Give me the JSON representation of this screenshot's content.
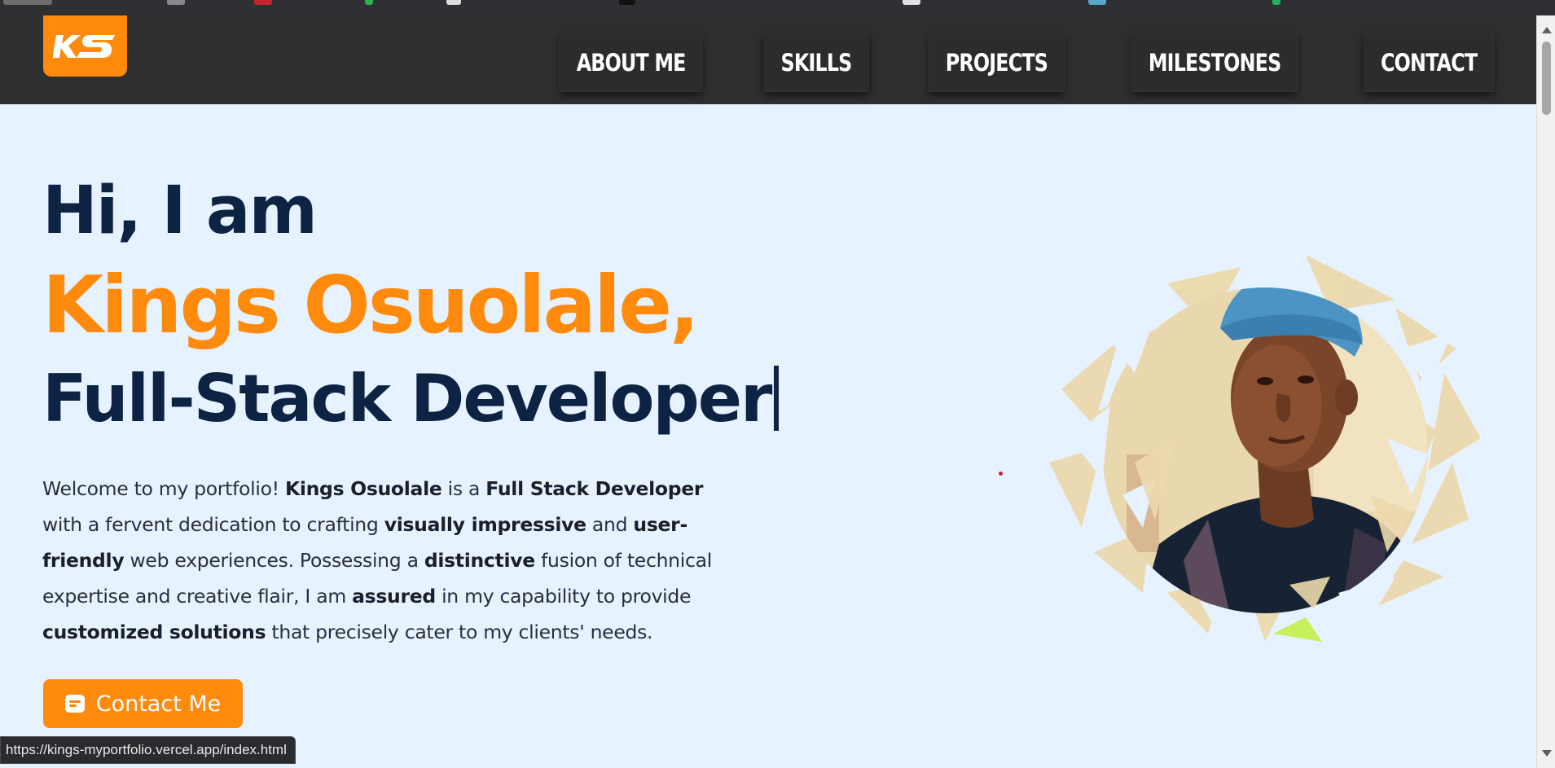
{
  "brand": {
    "logo_text": "KS",
    "accent_color": "#ff8a0c",
    "navy_color": "#0d2344",
    "nav_bg": "#2e2f31",
    "page_bg": "#e6f2ff"
  },
  "nav": {
    "items": [
      {
        "label": "ABOUT ME"
      },
      {
        "label": "SKILLS"
      },
      {
        "label": "PROJECTS"
      },
      {
        "label": "MILESTONES"
      },
      {
        "label": "CONTACT"
      }
    ]
  },
  "hero": {
    "greeting": "Hi, I am",
    "name": "Kings Osuolale,",
    "role": "Full-Stack Developer",
    "bio": {
      "p1": "Welcome to my portfolio! ",
      "b1": "Kings Osuolale",
      "p2": " is a ",
      "b2": "Full Stack Developer",
      "p3": " with a fervent dedication to crafting ",
      "b3": "visually impressive",
      "p4": " and ",
      "b4": "user-friendly",
      "p5": " web experiences. Possessing a ",
      "b5": "distinctive",
      "p6": " fusion of technical expertise and creative flair, I am ",
      "b6": "assured",
      "p7": " in my capability to provide ",
      "b7": "customized solutions",
      "p8": " that precisely cater to my clients' needs."
    },
    "contact_button": "Contact Me",
    "contact_icon": "chat-icon"
  },
  "status_bar": {
    "url": "https://kings-myportfolio.vercel.app/index.html"
  }
}
